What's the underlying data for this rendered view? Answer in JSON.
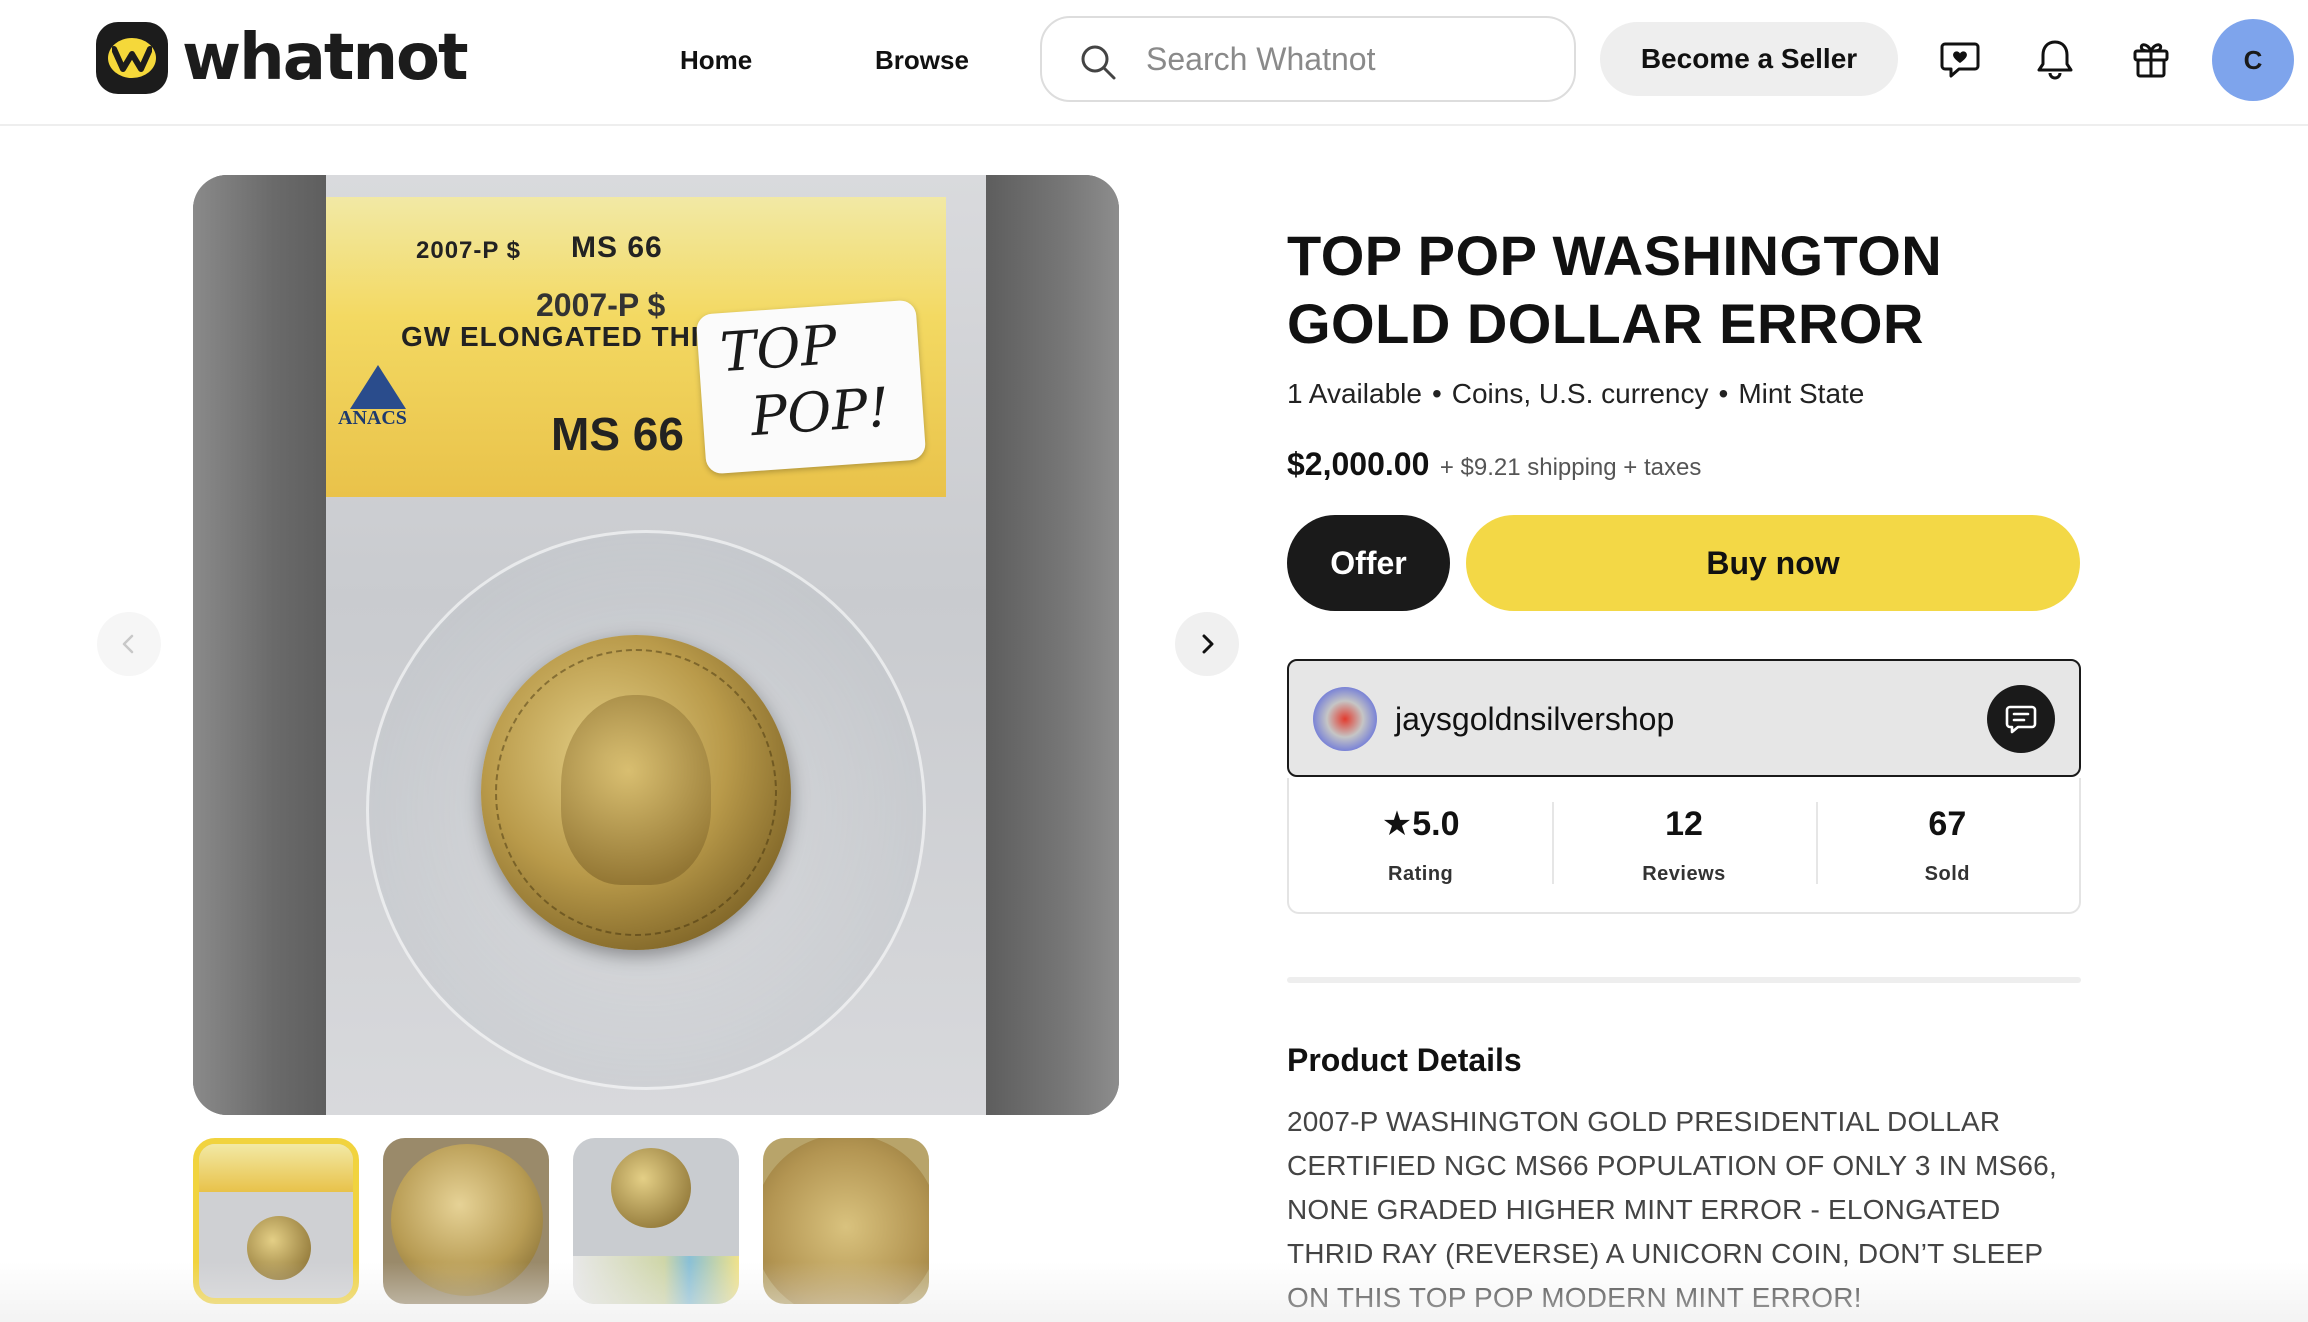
{
  "brand": {
    "name": "whatnot",
    "logo_icon": "whatnot-logo-icon",
    "logo_colors": {
      "mark_bg": "#1c1c1c",
      "mark_accent": "#f5d83a"
    }
  },
  "nav": {
    "home": "Home",
    "browse": "Browse"
  },
  "search": {
    "placeholder": "Search Whatnot",
    "value": ""
  },
  "header": {
    "become_seller": "Become a Seller",
    "icons": [
      "messages-heart-icon",
      "bell-icon",
      "gift-icon"
    ],
    "avatar_initial": "C",
    "avatar_color": "#7ea4ec"
  },
  "gallery": {
    "main_image": {
      "slab_grade_top": "2007-P $",
      "slab_grade_code": "MS 66",
      "slab_year": "2007-P $",
      "slab_variety": "GW ELONGATED THIRD RAY",
      "slab_grade": "MS 66",
      "grader": "ANACS",
      "sticker_line1": "TOP",
      "sticker_line2": "POP!"
    },
    "thumbnails_count": 4,
    "selected_thumbnail": 1,
    "accent_color": "#f1d33e"
  },
  "product": {
    "title": "TOP POP WASHINGTON GOLD DOLLAR ERROR",
    "available": "1 Available",
    "category": "Coins, U.S. currency",
    "condition": "Mint State",
    "price": "$2,000.00",
    "shipping": "+ $9.21 shipping + taxes",
    "offer_label": "Offer",
    "buy_label": "Buy now",
    "buy_color": "#f3d846"
  },
  "seller": {
    "name": "jaysgoldnsilvershop",
    "rating": "5.0",
    "rating_label": "Rating",
    "reviews": "12",
    "reviews_label": "Reviews",
    "sold": "67",
    "sold_label": "Sold"
  },
  "details": {
    "heading": "Product Details",
    "body": "2007-P WASHINGTON GOLD PRESIDENTIAL DOLLAR CERTIFIED NGC MS66 POPULATION OF ONLY 3 IN MS66, NONE GRADED HIGHER MINT ERROR - ELONGATED THRID RAY (REVERSE) A UNICORN COIN, DON’T SLEEP ON THIS TOP POP MODERN MINT ERROR!"
  }
}
